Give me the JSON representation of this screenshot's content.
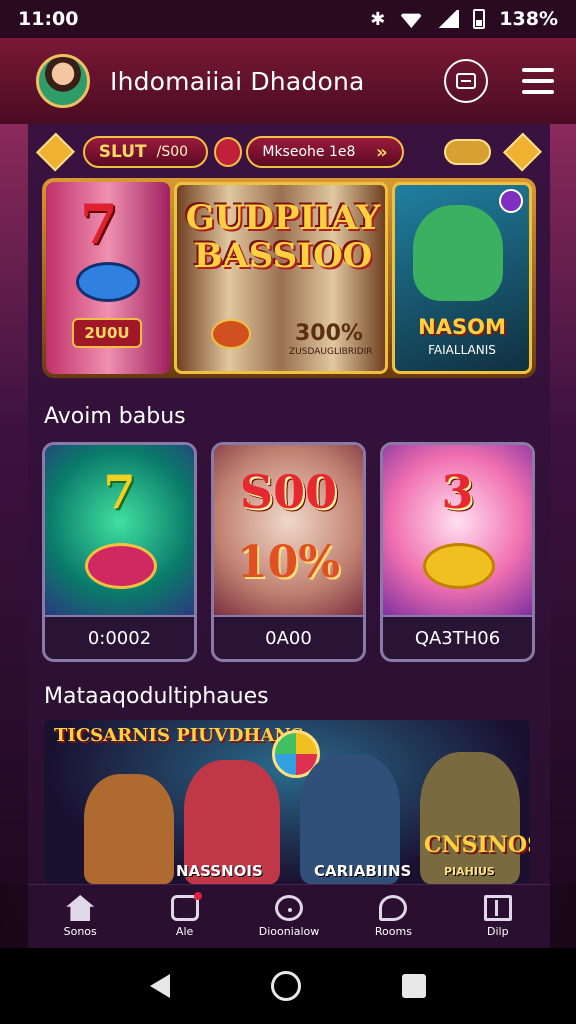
{
  "status": {
    "time": "11:00",
    "battery": "138%",
    "icons": [
      "bluetooth-icon",
      "wifi-icon",
      "signal-icon",
      "battery-icon"
    ]
  },
  "header": {
    "title": "Ihdomaiiai Dhadona",
    "bt_glyph": "✱"
  },
  "jackpot": {
    "slot_label": "SLUT",
    "slot_value": "/S00",
    "message": "Mkseohe 1e8",
    "chevron": "»"
  },
  "hero": {
    "left_symbol": "7",
    "left_value": "2U0U",
    "center_title": "GUDPIIAY BASSIOO",
    "center_percent": "300%",
    "center_sub": "ZUSDAUGLIBRIDIR",
    "right_title": "NASOM",
    "right_sub": "FAIALLANIS"
  },
  "bonus_section": {
    "title": "Avoim babus",
    "cards": [
      {
        "line1": "7",
        "line2": "",
        "value": "0:0002"
      },
      {
        "line1": "S00",
        "line2": "10%",
        "value": "0A00"
      },
      {
        "line1": "3",
        "line2": "",
        "value": "QA3TH06"
      }
    ]
  },
  "multiplayer_section": {
    "title": "Mataaqodultiphaues",
    "banner_top": "TICSARNIS PIUVDHANS",
    "cap_a": "NASSNOIS",
    "cap_b": "CARIABIINS",
    "cap_c": "CNSINOS",
    "cap_d": "PIAHIUS"
  },
  "nav": [
    {
      "label": "Sonos",
      "icon": "home-icon"
    },
    {
      "label": "Ale",
      "icon": "alerts-icon"
    },
    {
      "label": "Dioonialow",
      "icon": "discover-icon"
    },
    {
      "label": "Rooms",
      "icon": "rooms-icon"
    },
    {
      "label": "Dilp",
      "icon": "help-icon"
    }
  ],
  "colors": {
    "header": "#7a1836",
    "accent_gold": "#f0c040",
    "background": "#2a0f30"
  }
}
